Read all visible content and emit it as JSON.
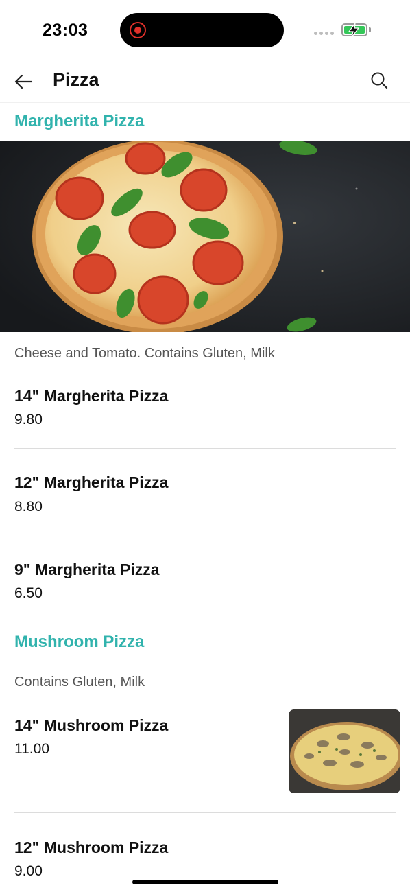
{
  "status": {
    "time": "23:03"
  },
  "header": {
    "title": "Pizza",
    "back_icon": "arrow-left-icon",
    "search_icon": "search-icon"
  },
  "colors": {
    "accent": "#31b3ad",
    "battery": "#34c759",
    "recording": "#e0302a"
  },
  "sections": [
    {
      "title": "Margherita Pizza",
      "description": "Cheese and Tomato. Contains Gluten, Milk",
      "items": [
        {
          "name": "14\" Margherita Pizza",
          "price": "9.80"
        },
        {
          "name": "12\" Margherita Pizza",
          "price": "8.80"
        },
        {
          "name": "9\" Margherita Pizza",
          "price": "6.50"
        }
      ]
    },
    {
      "title": "Mushroom Pizza",
      "description": "Contains Gluten, Milk",
      "items": [
        {
          "name": "14\" Mushroom Pizza",
          "price": "11.00"
        },
        {
          "name": "12\" Mushroom Pizza",
          "price": "9.00"
        }
      ]
    }
  ]
}
